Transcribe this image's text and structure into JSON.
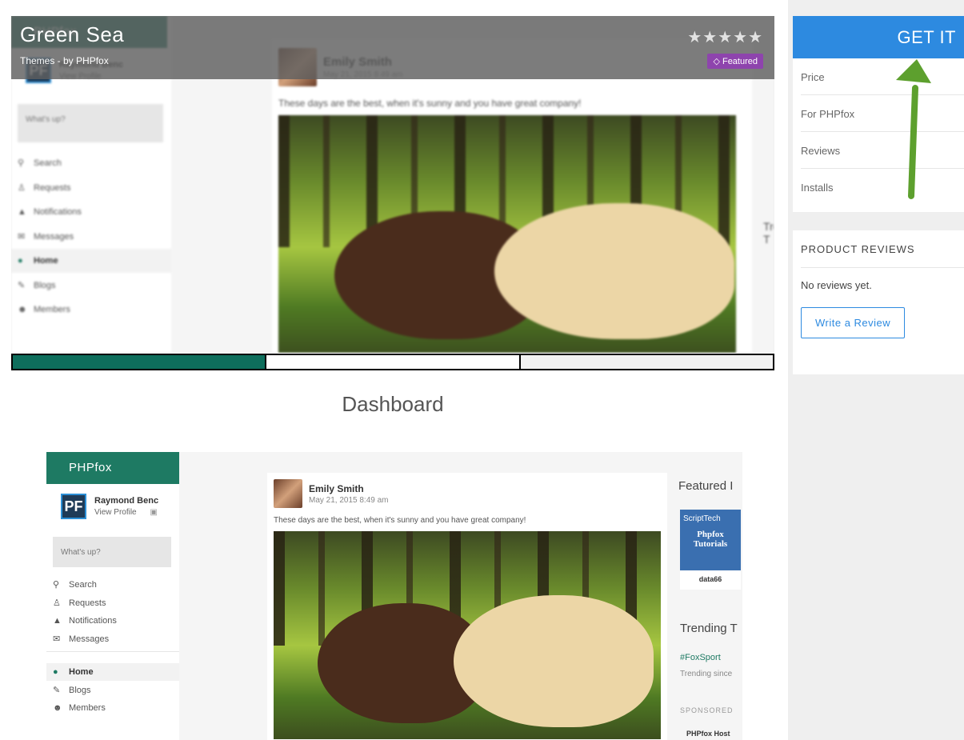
{
  "product": {
    "title": "Green Sea",
    "subtitle": "Themes  -  by PHPfox",
    "rating_stars": "★★★★★",
    "featured_badge": "Featured"
  },
  "gallery": {
    "active_index": 0,
    "thumbnail_count": 3
  },
  "section_title": "Dashboard",
  "mockup": {
    "brand": "PHPfox",
    "user_initials": "PF",
    "user_name": "Raymond Benc",
    "view_profile": "View Profile",
    "whats_up": "What's up?",
    "nav": [
      "Search",
      "Requests",
      "Notifications",
      "Messages",
      "Home",
      "Blogs",
      "Members"
    ],
    "post_author": "Emily Smith",
    "post_date": "May 21, 2015 8:49 am",
    "post_text": "These days are the best, when it's sunny and you have great company!",
    "featured_heading": "Featured I",
    "ad_brand": "ScriptTech",
    "ad_title_1": "Phpfox",
    "ad_title_2": "Tutorials",
    "ad_user": "data66",
    "trending_heading": "Trending T",
    "trending_tag": "#FoxSport",
    "trending_since": "Trending since",
    "sponsored": "SPONSORED",
    "sponsored_item": "PHPfox Host"
  },
  "sidebar": {
    "get_it": "GET IT",
    "info_rows": [
      "Price",
      "For PHPfox",
      "Reviews",
      "Installs"
    ],
    "reviews_heading": "PRODUCT REVIEWS",
    "no_reviews": "No reviews yet.",
    "write_review": "Write a Review"
  },
  "colors": {
    "accent_blue": "#2d8ae0",
    "brand_green": "#1e7a63",
    "featured_purple": "#8e44ad",
    "arrow_green": "#5da02e"
  }
}
